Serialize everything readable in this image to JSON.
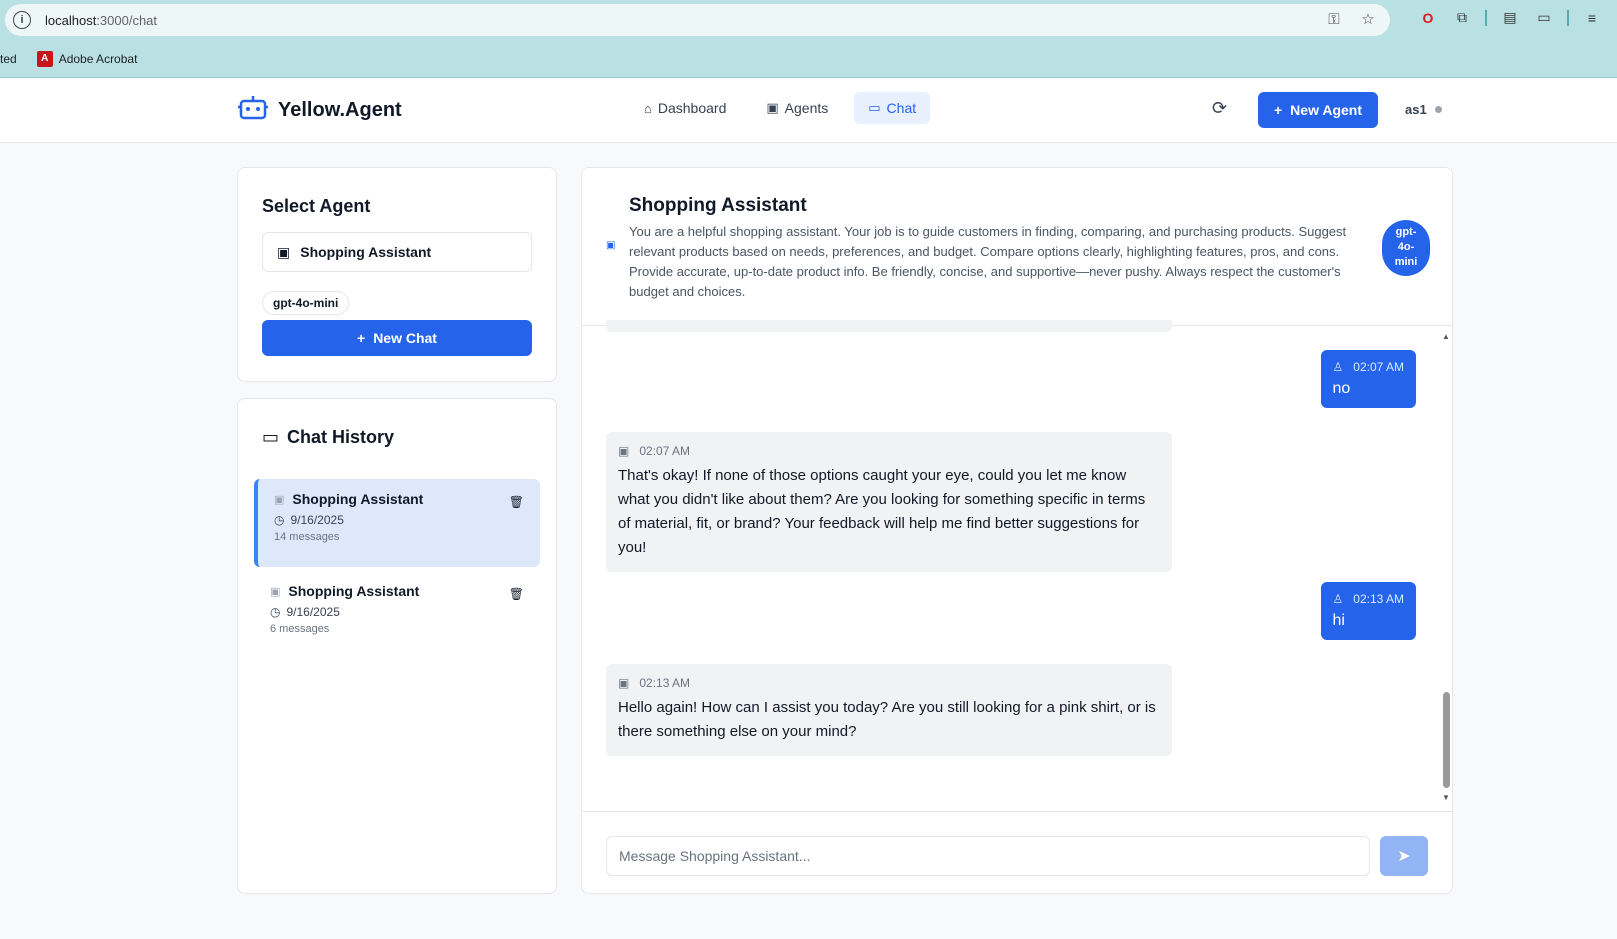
{
  "browser": {
    "url_host": "localhost",
    "url_path": ":3000/chat",
    "bookmarks": {
      "truncated": "ted",
      "acrobat_label": "Adobe Acrobat"
    }
  },
  "header": {
    "brand": "Yellow.Agent",
    "nav": [
      {
        "label": "Dashboard",
        "icon": "home-icon"
      },
      {
        "label": "Agents",
        "icon": "bot-icon"
      },
      {
        "label": "Chat",
        "icon": "message-icon",
        "active": true
      }
    ],
    "new_agent_label": "New Agent",
    "user": "as1"
  },
  "select_agent": {
    "title": "Select Agent",
    "selected": "Shopping Assistant",
    "model": "gpt-4o-mini",
    "new_chat_label": "New Chat"
  },
  "history": {
    "title": "Chat History",
    "items": [
      {
        "name": "Shopping Assistant",
        "date": "9/16/2025",
        "count": "14 messages",
        "active": true
      },
      {
        "name": "Shopping Assistant",
        "date": "9/16/2025",
        "count": "6 messages",
        "active": false
      }
    ]
  },
  "chat": {
    "title": "Shopping Assistant",
    "description": "You are a helpful shopping assistant. Your job is to guide customers in finding, comparing, and purchasing products. Suggest relevant products based on needs, preferences, and budget. Compare options clearly, highlighting features, pros, and cons. Provide accurate, up-to-date product info. Be friendly, concise, and supportive—never pushy. Always respect the customer's budget and choices.",
    "model_badge": "gpt-4o-mini",
    "messages": [
      {
        "role": "user",
        "time": "02:07 AM",
        "text": "no"
      },
      {
        "role": "assistant",
        "time": "02:07 AM",
        "text": "That's okay! If none of those options caught your eye, could you let me know what you didn't like about them? Are you looking for something specific in terms of material, fit, or brand? Your feedback will help me find better suggestions for you!"
      },
      {
        "role": "user",
        "time": "02:13 AM",
        "text": "hi"
      },
      {
        "role": "assistant",
        "time": "02:13 AM",
        "text": "Hello again! How can I assist you today? Are you still looking for a pink shirt, or is there something else on your mind?"
      }
    ],
    "input_placeholder": "Message Shopping Assistant...",
    "input_value": ""
  },
  "colors": {
    "primary": "#2563eb",
    "browser_chrome": "#b9e1e4",
    "bot_bubble": "#f1f2f4"
  }
}
